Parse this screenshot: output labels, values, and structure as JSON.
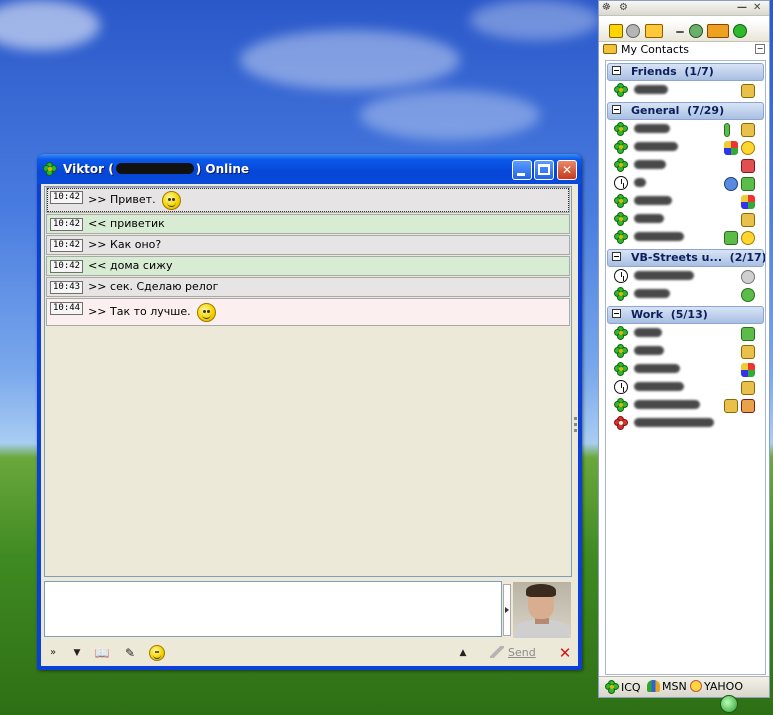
{
  "chat_window": {
    "title_prefix": "Viktor (",
    "title_suffix": ") Online",
    "messages": [
      {
        "time": "10:42",
        "text": ">> Привет.",
        "dir": "in",
        "smiley": true
      },
      {
        "time": "10:42",
        "text": "<< приветик",
        "dir": "out",
        "smiley": false
      },
      {
        "time": "10:42",
        "text": ">> Как оно?",
        "dir": "in",
        "smiley": false
      },
      {
        "time": "10:42",
        "text": "<< дома сижу",
        "dir": "out",
        "smiley": false
      },
      {
        "time": "10:43",
        "text": ">> сек. Сделаю релог",
        "dir": "in",
        "smiley": false
      },
      {
        "time": "10:44",
        "text": ">> Так то лучше.",
        "dir": "in",
        "smiley": true
      }
    ],
    "input_value": "",
    "send_label": "Send"
  },
  "contact_list": {
    "root_label": "My Contacts",
    "groups": [
      {
        "label": "Friends",
        "count": "(1/7)"
      },
      {
        "label": "General",
        "count": "(7/29)"
      },
      {
        "label": "VB-Streets u...",
        "count": "(2/17)"
      },
      {
        "label": "Work",
        "count": "(5/13)"
      }
    ],
    "networks": [
      {
        "label": "ICQ"
      },
      {
        "label": "MSN"
      },
      {
        "label": "YAHOO"
      }
    ]
  }
}
